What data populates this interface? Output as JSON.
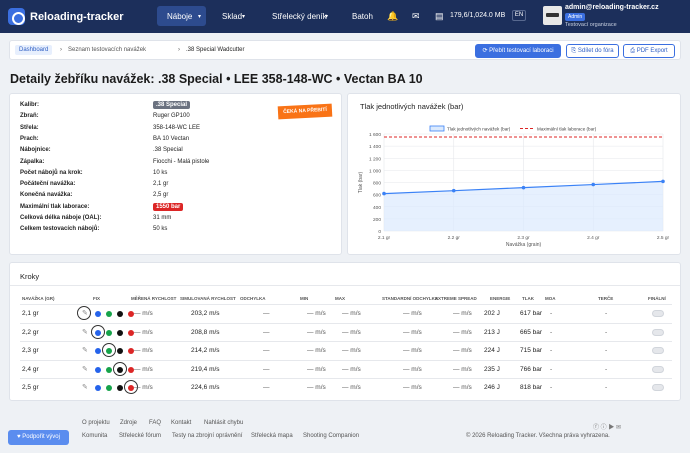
{
  "nav": {
    "brand": "Reloading-tracker",
    "items": [
      "Náboje",
      "Sklad",
      "Střelecký deník",
      "Batoh"
    ],
    "storage": "179,6/1,024.0 MB",
    "lang": "EN",
    "user_email": "admin@reloading-tracker.cz",
    "user_role": "Admin",
    "user_org": "Testovací organizace"
  },
  "breadcrumb": {
    "items": [
      "Dashboard",
      "Seznam testovacích navážek",
      ".38 Special Wadcutter"
    ]
  },
  "actions": {
    "recalc": "⟳ Přebít testovací laboraci",
    "share": "⎘ Sdílet do fóra",
    "pdf": "⎙ PDF Export"
  },
  "page_title": "Detaily žebříku navážek: .38 Special • LEE 358-148-WC • Vectan BA 10",
  "details": {
    "pending_badge": "ČEKÁ NA PŘEBITÍ",
    "rows": [
      {
        "label": "Kalibr:",
        "value": ".38 Special"
      },
      {
        "label": "Zbraň:",
        "value": "Ruger GP100"
      },
      {
        "label": "Střela:",
        "value": "358-148-WC LEE"
      },
      {
        "label": "Prach:",
        "value": "BA 10 Vectan"
      },
      {
        "label": "Nábojnice:",
        "value": ".38 Special"
      },
      {
        "label": "Zápalka:",
        "value": "Fiocchi - Malá pistole"
      },
      {
        "label": "Počet nábojů na krok:",
        "value": "10 ks"
      },
      {
        "label": "Počáteční navážka:",
        "value": "2,1 gr"
      },
      {
        "label": "Konečná navážka:",
        "value": "2,5 gr"
      },
      {
        "label": "Maximální tlak laborace:",
        "value": "1550 bar"
      },
      {
        "label": "Celková délka náboje (OAL):",
        "value": "31 mm"
      },
      {
        "label": "Celkem testovacích nábojů:",
        "value": "50 ks"
      }
    ]
  },
  "chart_title": "Tlak jednotlivých navážek (bar)",
  "chart_data": {
    "type": "line",
    "title": "Tlak jednotlivých navážek (bar)",
    "xlabel": "Navážka (grain)",
    "ylabel": "Tlak (bar)",
    "x": [
      "2.1 gr",
      "2.2 gr",
      "2.3 gr",
      "2.4 gr",
      "2.5 gr"
    ],
    "ylim": [
      0,
      1600
    ],
    "yticks": [
      "0",
      "200",
      "400",
      "600",
      "800",
      "1 000",
      "1 200",
      "1 400",
      "1 600"
    ],
    "legend_position": "top",
    "series": [
      {
        "name": "Tlak jednotlivých navážek (bar)",
        "values": [
          617,
          665,
          715,
          766,
          818
        ],
        "color": "#3b82f6"
      },
      {
        "name": "Maximální tlak laborace (bar)",
        "values": [
          1550,
          1550,
          1550,
          1550,
          1550
        ],
        "color": "#dc2626",
        "style": "dashed"
      }
    ]
  },
  "steps": {
    "title": "Kroky",
    "headers": [
      "Navážka (gr)",
      "Fix",
      "Měřená rychlost",
      "Simulovaná rychlost",
      "Odchylka",
      "Min",
      "Max",
      "Standardní odchylka",
      "Extreme spread",
      "Energie",
      "Tlak",
      "MOA",
      "Terče",
      "Finální"
    ],
    "rows": [
      {
        "charge": "2,1 gr",
        "measured": "— m/s",
        "sim": "203,2 m/s",
        "dev": "—",
        "min": "— m/s",
        "max": "— m/s",
        "sd": "— m/s",
        "es": "— m/s",
        "energy": "202 J",
        "pressure": "617 bar",
        "moa": "-",
        "targets": "-",
        "fix": 0
      },
      {
        "charge": "2,2 gr",
        "measured": "— m/s",
        "sim": "208,8 m/s",
        "dev": "—",
        "min": "— m/s",
        "max": "— m/s",
        "sd": "— m/s",
        "es": "— m/s",
        "energy": "213 J",
        "pressure": "665 bar",
        "moa": "-",
        "targets": "-",
        "fix": 1
      },
      {
        "charge": "2,3 gr",
        "measured": "— m/s",
        "sim": "214,2 m/s",
        "dev": "—",
        "min": "— m/s",
        "max": "— m/s",
        "sd": "— m/s",
        "es": "— m/s",
        "energy": "224 J",
        "pressure": "715 bar",
        "moa": "-",
        "targets": "-",
        "fix": 2
      },
      {
        "charge": "2,4 gr",
        "measured": "— m/s",
        "sim": "219,4 m/s",
        "dev": "—",
        "min": "— m/s",
        "max": "— m/s",
        "sd": "— m/s",
        "es": "— m/s",
        "energy": "235 J",
        "pressure": "766 bar",
        "moa": "-",
        "targets": "-",
        "fix": 3
      },
      {
        "charge": "2,5 gr",
        "measured": "— m/s",
        "sim": "224,6 m/s",
        "dev": "—",
        "min": "— m/s",
        "max": "— m/s",
        "sd": "— m/s",
        "es": "— m/s",
        "energy": "246 J",
        "pressure": "818 bar",
        "moa": "-",
        "targets": "-",
        "fix": 4
      }
    ],
    "fix_colors": [
      "#2563eb",
      "#16a34a",
      "#111111",
      "#dc2626"
    ]
  },
  "footer": {
    "links1": [
      "O projektu",
      "Zdroje",
      "FAQ",
      "Kontakt",
      "Nahlásit chybu"
    ],
    "links2": [
      "Komunita",
      "Střelecké fórum",
      "Testy na zbrojní oprávnění",
      "Střelecká mapa",
      "Shooting Companion"
    ],
    "copyright": "© 2026 Reloading Tracker. Všechna práva vyhrazena.",
    "support": "Podpořit vývoj"
  }
}
